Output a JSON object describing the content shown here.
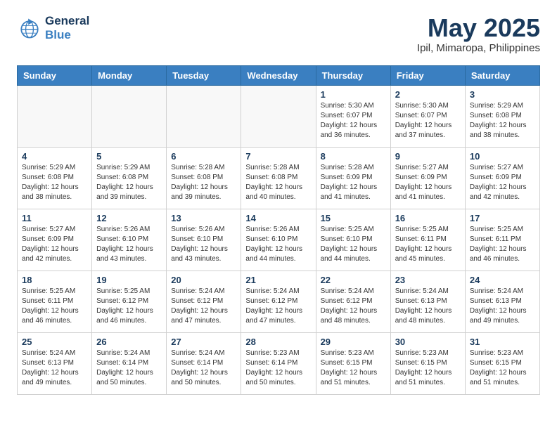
{
  "logo": {
    "line1": "General",
    "line2": "Blue"
  },
  "title": {
    "month_year": "May 2025",
    "location": "Ipil, Mimaropa, Philippines"
  },
  "weekdays": [
    "Sunday",
    "Monday",
    "Tuesday",
    "Wednesday",
    "Thursday",
    "Friday",
    "Saturday"
  ],
  "weeks": [
    [
      {
        "day": "",
        "info": ""
      },
      {
        "day": "",
        "info": ""
      },
      {
        "day": "",
        "info": ""
      },
      {
        "day": "",
        "info": ""
      },
      {
        "day": "1",
        "info": "Sunrise: 5:30 AM\nSunset: 6:07 PM\nDaylight: 12 hours\nand 36 minutes."
      },
      {
        "day": "2",
        "info": "Sunrise: 5:30 AM\nSunset: 6:07 PM\nDaylight: 12 hours\nand 37 minutes."
      },
      {
        "day": "3",
        "info": "Sunrise: 5:29 AM\nSunset: 6:08 PM\nDaylight: 12 hours\nand 38 minutes."
      }
    ],
    [
      {
        "day": "4",
        "info": "Sunrise: 5:29 AM\nSunset: 6:08 PM\nDaylight: 12 hours\nand 38 minutes."
      },
      {
        "day": "5",
        "info": "Sunrise: 5:29 AM\nSunset: 6:08 PM\nDaylight: 12 hours\nand 39 minutes."
      },
      {
        "day": "6",
        "info": "Sunrise: 5:28 AM\nSunset: 6:08 PM\nDaylight: 12 hours\nand 39 minutes."
      },
      {
        "day": "7",
        "info": "Sunrise: 5:28 AM\nSunset: 6:08 PM\nDaylight: 12 hours\nand 40 minutes."
      },
      {
        "day": "8",
        "info": "Sunrise: 5:28 AM\nSunset: 6:09 PM\nDaylight: 12 hours\nand 41 minutes."
      },
      {
        "day": "9",
        "info": "Sunrise: 5:27 AM\nSunset: 6:09 PM\nDaylight: 12 hours\nand 41 minutes."
      },
      {
        "day": "10",
        "info": "Sunrise: 5:27 AM\nSunset: 6:09 PM\nDaylight: 12 hours\nand 42 minutes."
      }
    ],
    [
      {
        "day": "11",
        "info": "Sunrise: 5:27 AM\nSunset: 6:09 PM\nDaylight: 12 hours\nand 42 minutes."
      },
      {
        "day": "12",
        "info": "Sunrise: 5:26 AM\nSunset: 6:10 PM\nDaylight: 12 hours\nand 43 minutes."
      },
      {
        "day": "13",
        "info": "Sunrise: 5:26 AM\nSunset: 6:10 PM\nDaylight: 12 hours\nand 43 minutes."
      },
      {
        "day": "14",
        "info": "Sunrise: 5:26 AM\nSunset: 6:10 PM\nDaylight: 12 hours\nand 44 minutes."
      },
      {
        "day": "15",
        "info": "Sunrise: 5:25 AM\nSunset: 6:10 PM\nDaylight: 12 hours\nand 44 minutes."
      },
      {
        "day": "16",
        "info": "Sunrise: 5:25 AM\nSunset: 6:11 PM\nDaylight: 12 hours\nand 45 minutes."
      },
      {
        "day": "17",
        "info": "Sunrise: 5:25 AM\nSunset: 6:11 PM\nDaylight: 12 hours\nand 46 minutes."
      }
    ],
    [
      {
        "day": "18",
        "info": "Sunrise: 5:25 AM\nSunset: 6:11 PM\nDaylight: 12 hours\nand 46 minutes."
      },
      {
        "day": "19",
        "info": "Sunrise: 5:25 AM\nSunset: 6:12 PM\nDaylight: 12 hours\nand 46 minutes."
      },
      {
        "day": "20",
        "info": "Sunrise: 5:24 AM\nSunset: 6:12 PM\nDaylight: 12 hours\nand 47 minutes."
      },
      {
        "day": "21",
        "info": "Sunrise: 5:24 AM\nSunset: 6:12 PM\nDaylight: 12 hours\nand 47 minutes."
      },
      {
        "day": "22",
        "info": "Sunrise: 5:24 AM\nSunset: 6:12 PM\nDaylight: 12 hours\nand 48 minutes."
      },
      {
        "day": "23",
        "info": "Sunrise: 5:24 AM\nSunset: 6:13 PM\nDaylight: 12 hours\nand 48 minutes."
      },
      {
        "day": "24",
        "info": "Sunrise: 5:24 AM\nSunset: 6:13 PM\nDaylight: 12 hours\nand 49 minutes."
      }
    ],
    [
      {
        "day": "25",
        "info": "Sunrise: 5:24 AM\nSunset: 6:13 PM\nDaylight: 12 hours\nand 49 minutes."
      },
      {
        "day": "26",
        "info": "Sunrise: 5:24 AM\nSunset: 6:14 PM\nDaylight: 12 hours\nand 50 minutes."
      },
      {
        "day": "27",
        "info": "Sunrise: 5:24 AM\nSunset: 6:14 PM\nDaylight: 12 hours\nand 50 minutes."
      },
      {
        "day": "28",
        "info": "Sunrise: 5:23 AM\nSunset: 6:14 PM\nDaylight: 12 hours\nand 50 minutes."
      },
      {
        "day": "29",
        "info": "Sunrise: 5:23 AM\nSunset: 6:15 PM\nDaylight: 12 hours\nand 51 minutes."
      },
      {
        "day": "30",
        "info": "Sunrise: 5:23 AM\nSunset: 6:15 PM\nDaylight: 12 hours\nand 51 minutes."
      },
      {
        "day": "31",
        "info": "Sunrise: 5:23 AM\nSunset: 6:15 PM\nDaylight: 12 hours\nand 51 minutes."
      }
    ]
  ]
}
